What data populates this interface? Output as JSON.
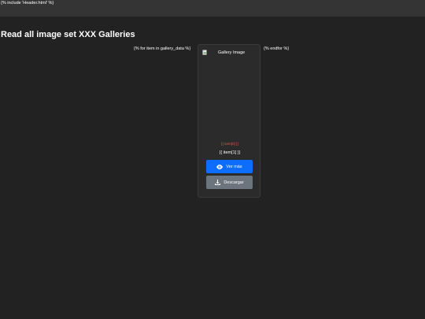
{
  "header": {
    "include_text": "{% include 'Header.html' %}"
  },
  "page": {
    "title": "Read all image set XXX Galleries"
  },
  "template": {
    "for_loop": "{% for item in gallery_data %}",
    "endfor": "{% endfor %}"
  },
  "card": {
    "image_alt": "Gallery Image",
    "item_red": "{{ item[0] }}",
    "item_white": "{{ item[1] }}",
    "view_button_label": "Ver más",
    "download_button_label": "Descargar",
    "icons": {
      "image": "broken-image-icon",
      "view": "eye-icon",
      "download": "download-icon"
    }
  },
  "colors": {
    "background": "#222222",
    "topbar": "#343434",
    "card": "#2b2b2b",
    "primary": "#0d6efd",
    "secondary": "#6c757d",
    "danger_text": "#e0584f"
  }
}
